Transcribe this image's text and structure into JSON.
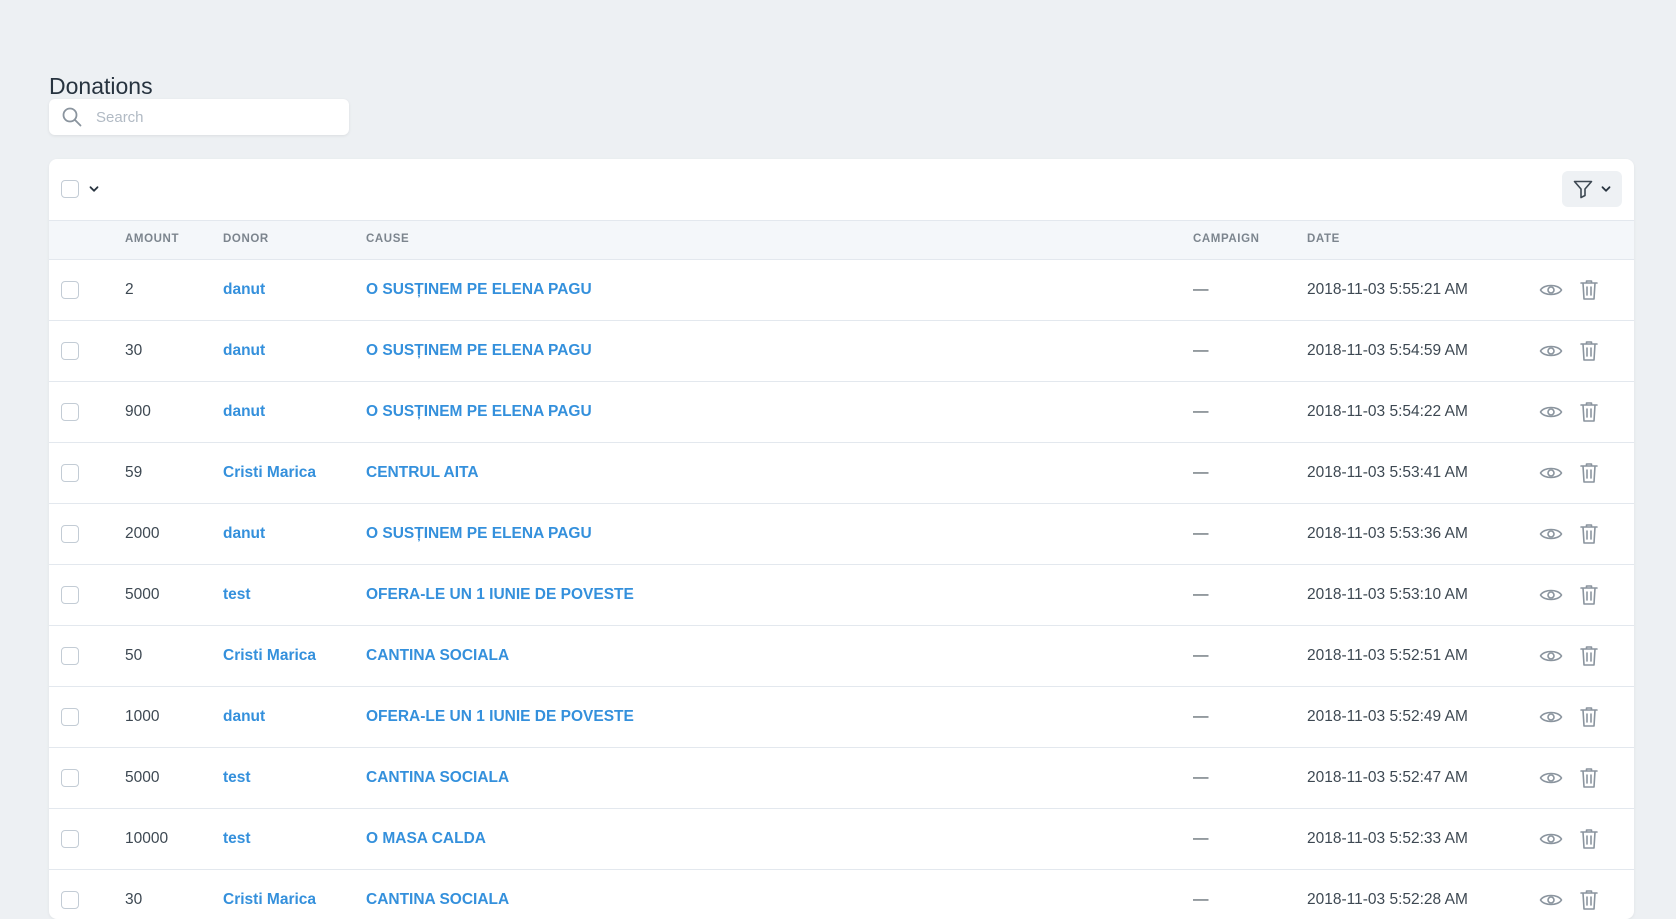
{
  "page": {
    "title": "Donations",
    "search_placeholder": "Search"
  },
  "colors": {
    "background": "#edf0f3",
    "link": "#3490dc",
    "header_bg": "#f4f7fa",
    "muted": "#7c858e"
  },
  "icons": {
    "search": "search-icon",
    "chevron": "chevron-down-icon",
    "filter": "filter-icon",
    "view": "eye-icon",
    "delete": "trash-icon"
  },
  "table": {
    "columns": [
      "Amount",
      "Donor",
      "Cause",
      "Campaign",
      "Date"
    ],
    "rows": [
      {
        "amount": "2",
        "donor": "danut",
        "cause": "O SUSȚINEM PE ELENA PAGU",
        "campaign": "—",
        "date": "2018-11-03 5:55:21 AM"
      },
      {
        "amount": "30",
        "donor": "danut",
        "cause": "O SUSȚINEM PE ELENA PAGU",
        "campaign": "—",
        "date": "2018-11-03 5:54:59 AM"
      },
      {
        "amount": "900",
        "donor": "danut",
        "cause": "O SUSȚINEM PE ELENA PAGU",
        "campaign": "—",
        "date": "2018-11-03 5:54:22 AM"
      },
      {
        "amount": "59",
        "donor": "Cristi Marica",
        "cause": "CENTRUL AITA",
        "campaign": "—",
        "date": "2018-11-03 5:53:41 AM"
      },
      {
        "amount": "2000",
        "donor": "danut",
        "cause": "O SUSȚINEM PE ELENA PAGU",
        "campaign": "—",
        "date": "2018-11-03 5:53:36 AM"
      },
      {
        "amount": "5000",
        "donor": "test",
        "cause": "OFERA-LE UN 1 IUNIE DE POVESTE",
        "campaign": "—",
        "date": "2018-11-03 5:53:10 AM"
      },
      {
        "amount": "50",
        "donor": "Cristi Marica",
        "cause": "CANTINA SOCIALA",
        "campaign": "—",
        "date": "2018-11-03 5:52:51 AM"
      },
      {
        "amount": "1000",
        "donor": "danut",
        "cause": "OFERA-LE UN 1 IUNIE DE POVESTE",
        "campaign": "—",
        "date": "2018-11-03 5:52:49 AM"
      },
      {
        "amount": "5000",
        "donor": "test",
        "cause": "CANTINA SOCIALA",
        "campaign": "—",
        "date": "2018-11-03 5:52:47 AM"
      },
      {
        "amount": "10000",
        "donor": "test",
        "cause": "O MASA CALDA",
        "campaign": "—",
        "date": "2018-11-03 5:52:33 AM"
      },
      {
        "amount": "30",
        "donor": "Cristi Marica",
        "cause": "CANTINA SOCIALA",
        "campaign": "—",
        "date": "2018-11-03 5:52:28 AM"
      }
    ]
  }
}
